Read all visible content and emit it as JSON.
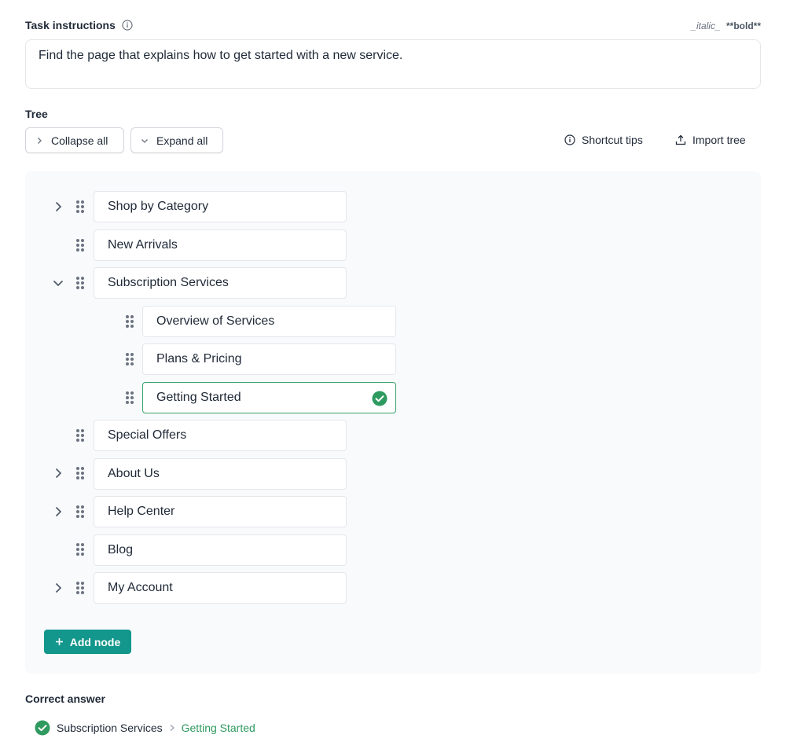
{
  "task": {
    "label": "Task instructions",
    "markdown_hint_italic": "_italic_",
    "markdown_hint_bold": "**bold**",
    "text": "Find the page that explains how to get started with a new service."
  },
  "tree": {
    "label": "Tree",
    "collapse_all": "Collapse all",
    "expand_all": "Expand all",
    "shortcut_tips": "Shortcut tips",
    "import_tree": "Import tree",
    "nodes": [
      {
        "label": "Shop by Category",
        "expandable": true,
        "expanded": false,
        "level": 0
      },
      {
        "label": "New Arrivals",
        "expandable": false,
        "level": 0
      },
      {
        "label": "Subscription Services",
        "expandable": true,
        "expanded": true,
        "level": 0
      },
      {
        "label": "Overview of Services",
        "expandable": false,
        "level": 1
      },
      {
        "label": "Plans & Pricing",
        "expandable": false,
        "level": 1
      },
      {
        "label": "Getting Started",
        "expandable": false,
        "level": 1,
        "correct": true
      },
      {
        "label": "Special Offers",
        "expandable": false,
        "level": 0
      },
      {
        "label": "About Us",
        "expandable": true,
        "expanded": false,
        "level": 0
      },
      {
        "label": "Help Center",
        "expandable": true,
        "expanded": false,
        "level": 0
      },
      {
        "label": "Blog",
        "expandable": false,
        "level": 0
      },
      {
        "label": "My Account",
        "expandable": true,
        "expanded": false,
        "level": 0
      }
    ],
    "add_node": "Add node"
  },
  "answer": {
    "label": "Correct answer",
    "path": [
      "Subscription Services",
      "Getting Started"
    ]
  },
  "colors": {
    "accent": "#13968b",
    "success": "#2f9a5f",
    "panel_bg": "#f8fafc"
  }
}
